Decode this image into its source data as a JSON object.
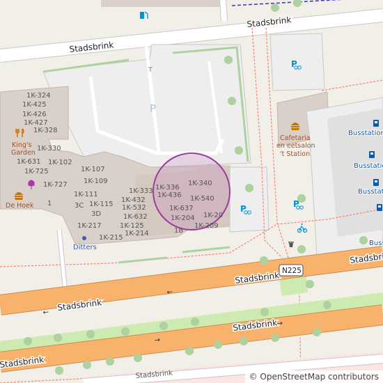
{
  "roads": {
    "top": "Stadsbrink",
    "main_center": "Stadsbrink",
    "main_left": "Stadsbrink",
    "lower": "Stadsbrink",
    "lower_left": "Stadsbrink",
    "bottom": "Stadsbrink",
    "right_upper": "Stadsbrink",
    "shield": "N225"
  },
  "units": {
    "u1": "1K-324",
    "u2": "1K-425",
    "u3": "1K-426",
    "u4": "1K-427",
    "u5": "1K-328",
    "u6": "1K-330",
    "u7": "1K-631",
    "u8": "1K-102",
    "u9": "1K-725",
    "u10": "1K-107",
    "u11": "1K-109",
    "u12": "1K-727",
    "u13": "1",
    "u14": "1K-111",
    "u15": "3C",
    "u16": "1K-115",
    "u17": "3D",
    "u18": "1K-217",
    "u19": "1K-125",
    "u20": "1K-215",
    "u21": "1K-333",
    "u22": "1K-432",
    "u23": "1K-532",
    "u24": "1K-632",
    "u25": "1K-214",
    "u26": "1K-336",
    "u27": "1K-436",
    "u28": "1K-340",
    "u29": "1K-540",
    "u30": "1K-637",
    "u31": "1K-204",
    "u32": "1K-20",
    "u33": "1K-209",
    "u34": "1B"
  },
  "pois": {
    "kings_garden_1": "King's",
    "kings_garden_2": "Garden",
    "de_hoek": "De Hoek",
    "ditters": "Ditters",
    "cafetaria_1": "Cafetaria",
    "cafetaria_2": "en eetsalon",
    "cafetaria_3": "'t Station",
    "parking": "P"
  },
  "bus_stops": [
    "Busstation",
    "Busstation",
    "Busstation",
    "Busstation"
  ],
  "attribution": {
    "symbol": "©",
    "text": "OpenStreetMap contributors"
  },
  "colors": {
    "land": "#f2efe9",
    "building": "#d9d0c9",
    "parking": "#eeeeee",
    "trunk_road": "#f9b26b",
    "green_strip": "#cdebb0",
    "tree": "#aed1a0",
    "footway": "#fa8072",
    "blue_icon": "#0092da",
    "highlight": "#c080c0"
  }
}
